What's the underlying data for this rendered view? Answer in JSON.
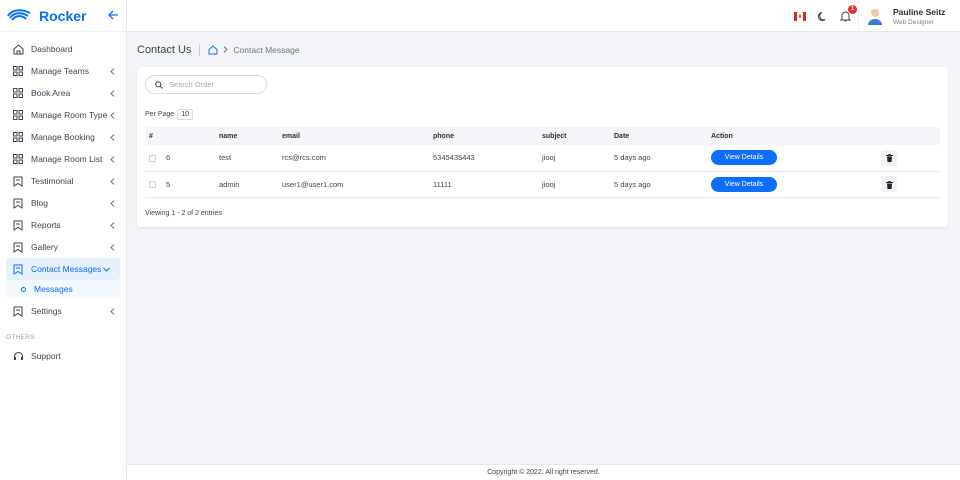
{
  "brand": {
    "name": "Rocker",
    "accent": "#0d6efd"
  },
  "sidebar": {
    "items": [
      {
        "label": "Dashboard",
        "icon": "home-icon",
        "caret": false
      },
      {
        "label": "Manage Teams",
        "icon": "grid-icon",
        "caret": true
      },
      {
        "label": "Book Area",
        "icon": "grid-icon",
        "caret": true
      },
      {
        "label": "Manage Room Type",
        "icon": "grid-icon",
        "caret": true
      },
      {
        "label": "Manage Booking",
        "icon": "grid-icon",
        "caret": true
      },
      {
        "label": "Manage Room List",
        "icon": "grid-icon",
        "caret": true
      },
      {
        "label": "Testimonial",
        "icon": "bookmark-icon",
        "caret": true
      },
      {
        "label": "Blog",
        "icon": "bookmark-icon",
        "caret": true
      },
      {
        "label": "Reports",
        "icon": "bookmark-icon",
        "caret": true
      },
      {
        "label": "Gallery",
        "icon": "bookmark-icon",
        "caret": true
      },
      {
        "label": "Contact Messages",
        "icon": "bookmark-icon",
        "caret": true,
        "active": true
      }
    ],
    "submenu": {
      "label": "Messages"
    },
    "after": [
      {
        "label": "Settings",
        "icon": "bookmark-icon",
        "caret": true
      }
    ],
    "section_label": "OTHERS",
    "support": {
      "label": "Support",
      "icon": "headset-icon"
    }
  },
  "topbar": {
    "notification_count": "1",
    "user": {
      "name": "Pauline Seitz",
      "role": "Web Designer"
    }
  },
  "page": {
    "title": "Contact Us",
    "breadcrumb": "Contact Message"
  },
  "search": {
    "placeholder": "Search Order"
  },
  "per_page": {
    "label": "Per Page",
    "value": "10"
  },
  "table": {
    "headers": [
      "#",
      "name",
      "email",
      "phone",
      "subject",
      "Date",
      "Action"
    ],
    "rows": [
      {
        "id": "6",
        "name": "test",
        "email": "rcs@rcs.com",
        "phone": "5345435443",
        "subject": "jiooj",
        "date": "5 days ago",
        "action": "View Details"
      },
      {
        "id": "5",
        "name": "admin",
        "email": "user1@user1.com",
        "phone": "11111",
        "subject": "jiooj",
        "date": "5 days ago",
        "action": "View Details"
      }
    ]
  },
  "entries_text": "Viewing 1 - 2 of 2 entries",
  "footer": {
    "text": "Copyright © 2022. All right reserved."
  }
}
